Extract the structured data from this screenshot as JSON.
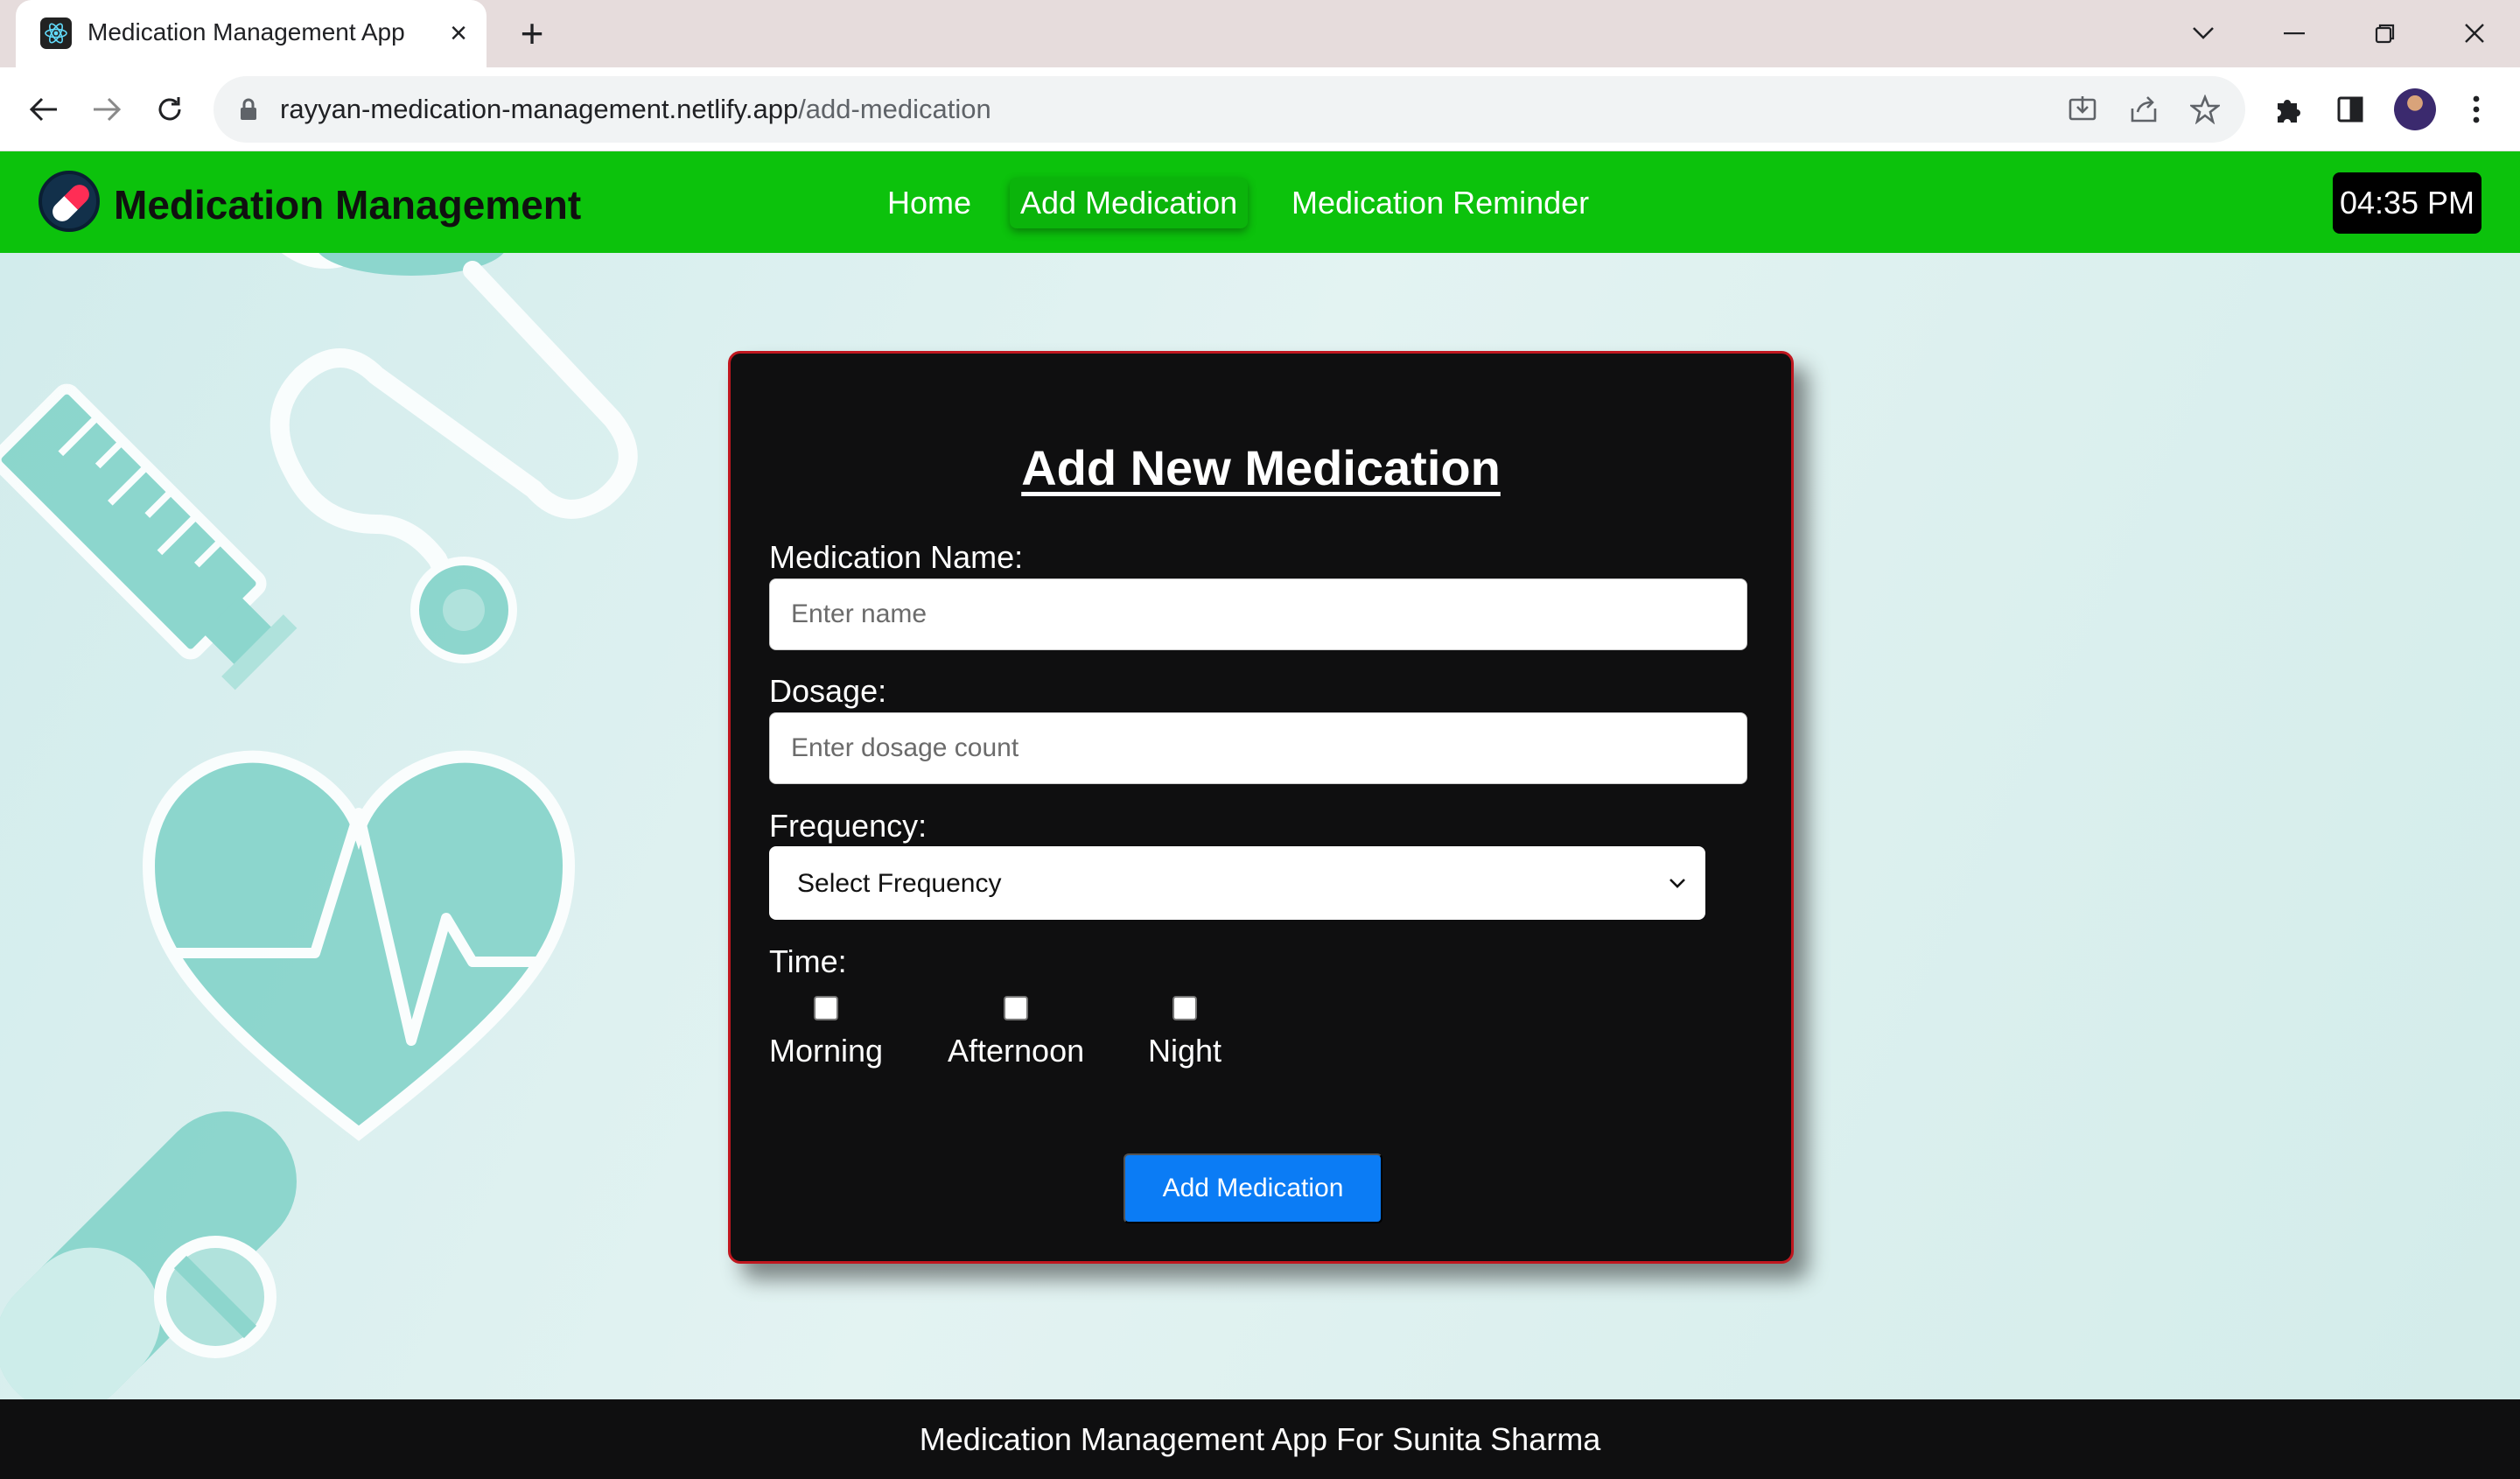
{
  "browser": {
    "tab_title": "Medication Management App",
    "url_host": "rayyan-medication-management.netlify.app",
    "url_path": "/add-medication"
  },
  "header": {
    "brand": "Medication Management",
    "nav": [
      "Home",
      "Add Medication",
      "Medication Reminder"
    ],
    "active_nav": "Add Medication",
    "clock": "04:35 PM"
  },
  "form": {
    "title": "Add New Medication",
    "name_label": "Medication Name:",
    "name_placeholder": "Enter name",
    "dosage_label": "Dosage:",
    "dosage_placeholder": "Enter dosage count",
    "frequency_label": "Frequency:",
    "frequency_value": "Select Frequency",
    "time_label": "Time:",
    "time_options": [
      "Morning",
      "Afternoon",
      "Night"
    ],
    "submit_label": "Add Medication"
  },
  "footer": {
    "text": "Medication Management App For Sunita Sharma"
  },
  "colors": {
    "header_green": "#0cc20c",
    "card_bg": "#0f0f10",
    "card_border": "#c0171f",
    "submit_blue": "#0b7cf5",
    "decor_teal": "#7fd1c7"
  }
}
